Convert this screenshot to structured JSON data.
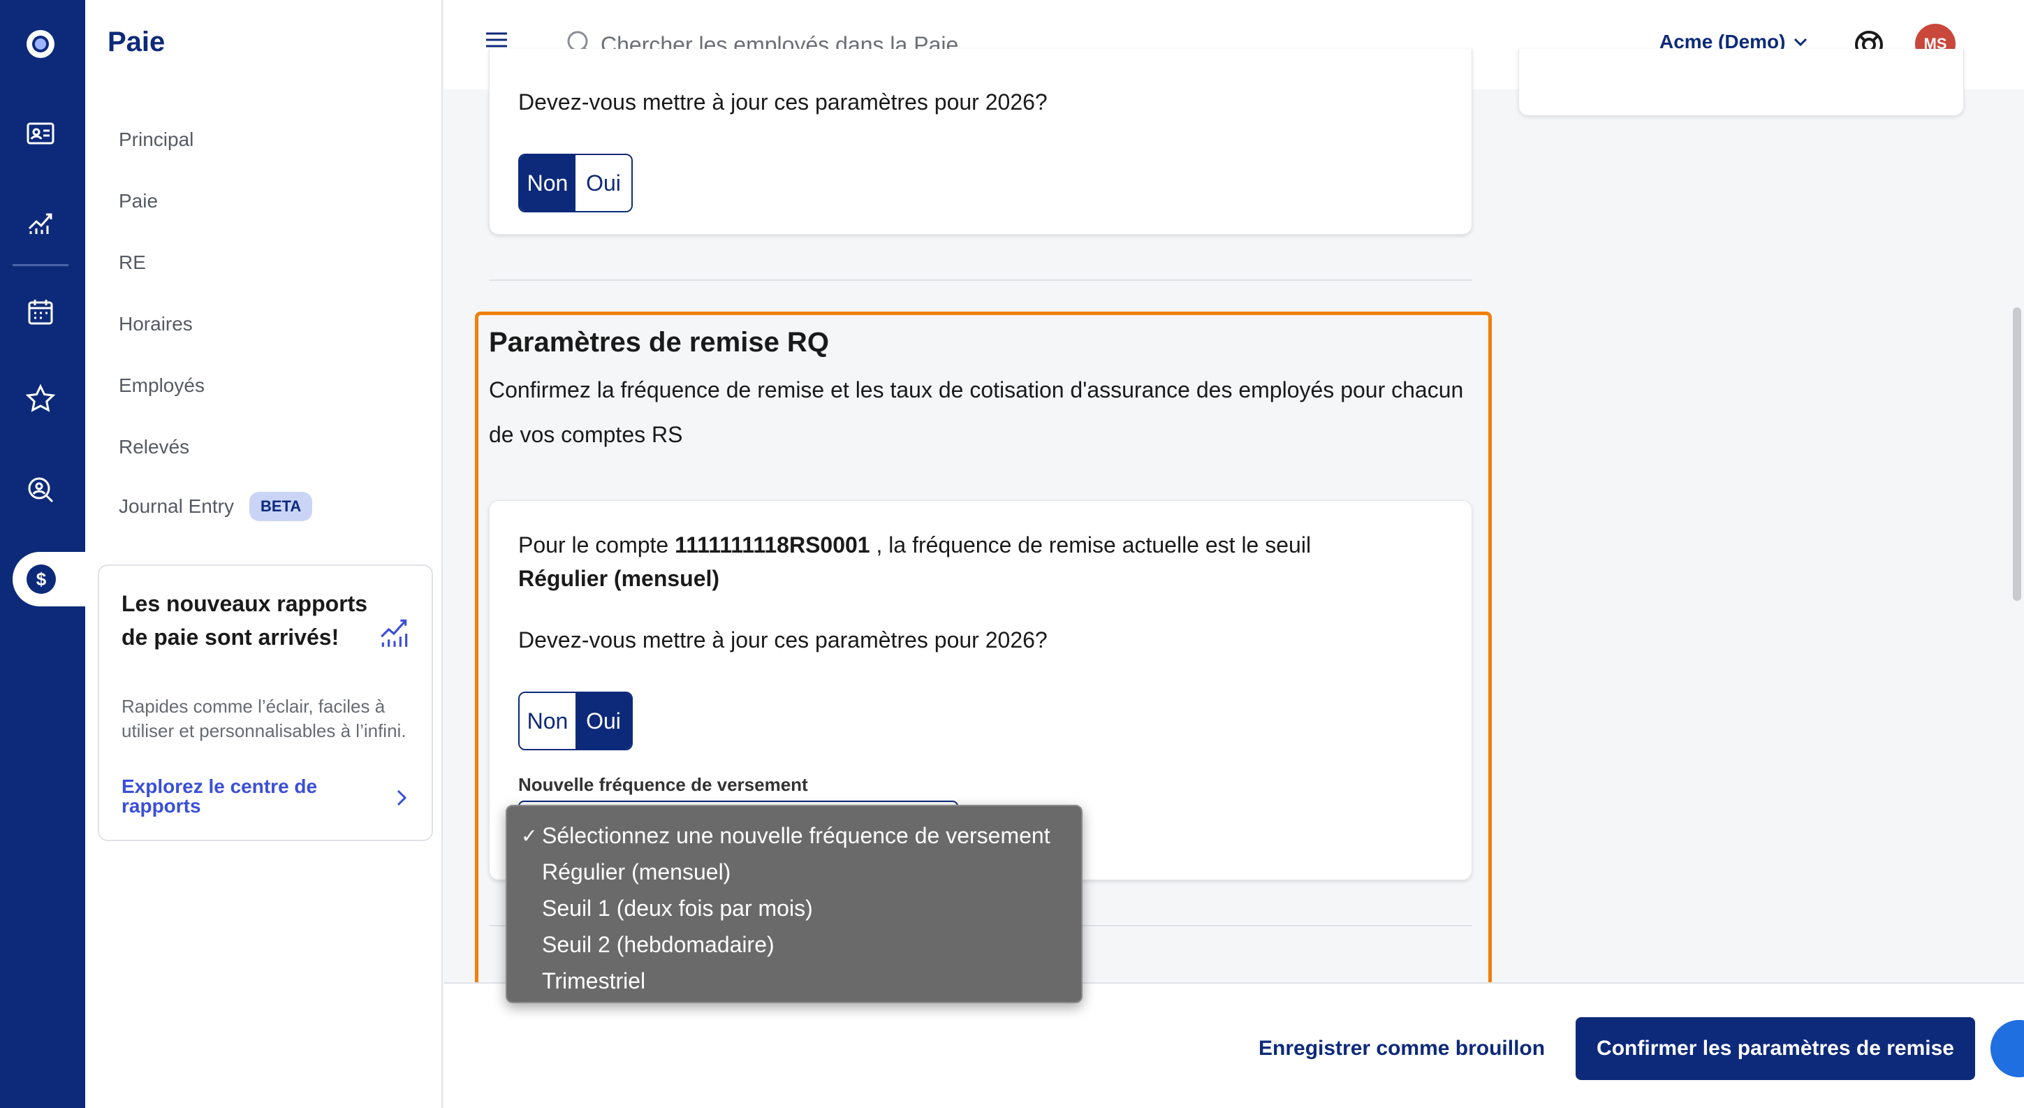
{
  "app": {
    "title": "Paie",
    "nav": [
      {
        "label": "Principal"
      },
      {
        "label": "Paie"
      },
      {
        "label": "RE"
      },
      {
        "label": "Horaires"
      },
      {
        "label": "Employés"
      },
      {
        "label": "Relevés"
      },
      {
        "label": "Journal Entry",
        "badge": "BETA"
      }
    ],
    "promo": {
      "title": "Les nouveaux rapports de paie sont arrivés!",
      "text": "Rapides comme l’éclair, faciles à utiliser et personnalisables à l’infini.",
      "link": "Explorez le centre de rapports"
    }
  },
  "topbar": {
    "search_placeholder": "Chercher les employés dans la Paie",
    "company": "Acme (Demo)",
    "avatar_initials": "MS"
  },
  "top_card": {
    "question": "Devez-vous mettre à jour ces paramètres pour 2026?",
    "toggle": {
      "no": "Non",
      "yes": "Oui",
      "selected": "Non"
    }
  },
  "section": {
    "title": "Paramètres de remise RQ",
    "description": "Confirmez la fréquence de remise et les taux de cotisation d'assurance des employés pour chacun de vos comptes RS",
    "account_prefix": "Pour le compte",
    "account_number": "1111111118RS0001",
    "account_suffix": ", la fréquence de remise actuelle est le seuil",
    "current_frequency": "Régulier (mensuel)",
    "question": "Devez-vous mettre à jour ces paramètres pour 2026?",
    "toggle": {
      "no": "Non",
      "yes": "Oui",
      "selected": "Oui"
    },
    "field_label": "Nouvelle fréquence de versement",
    "dropdown_options": [
      {
        "label": "Sélectionnez une nouvelle fréquence de versement",
        "selected": true
      },
      {
        "label": "Régulier (mensuel)",
        "selected": false
      },
      {
        "label": "Seuil 1 (deux fois par mois)",
        "selected": false
      },
      {
        "label": "Seuil 2 (hebdomadaire)",
        "selected": false
      },
      {
        "label": "Trimestriel",
        "selected": false
      }
    ],
    "check_mark": "✓"
  },
  "footer": {
    "save_draft": "Enregistrer comme brouillon",
    "confirm": "Confirmer les paramètres de remise"
  },
  "colors": {
    "brand": "#0d2a7a",
    "highlight": "#f07f0c",
    "link": "#3a4fd7",
    "avatar": "#c9473b"
  }
}
